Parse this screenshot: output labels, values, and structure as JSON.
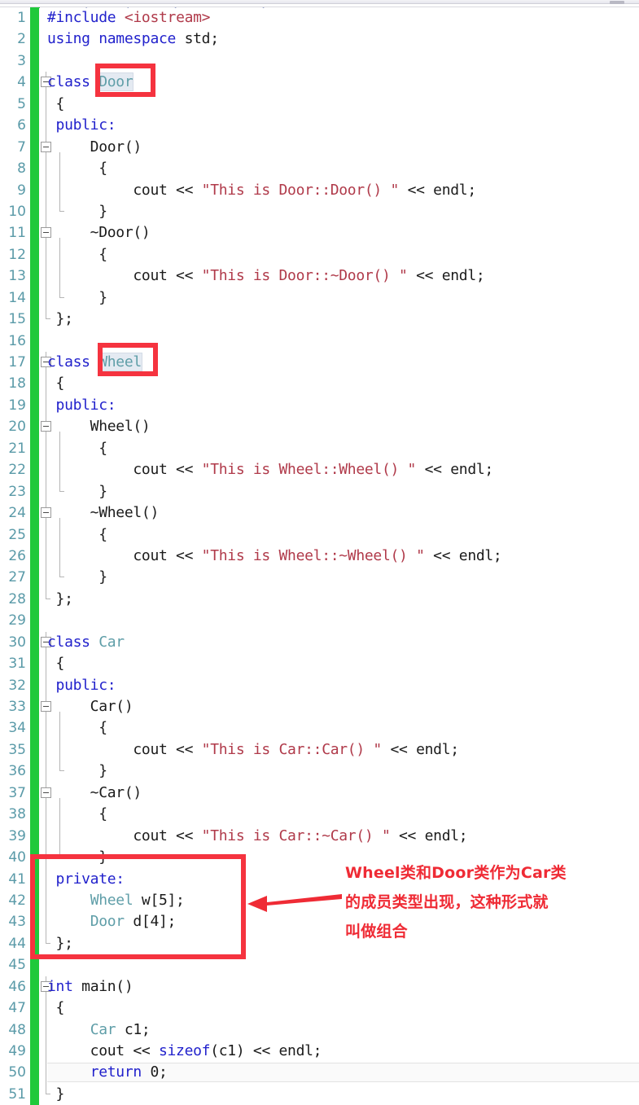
{
  "app": {
    "type": "code-editor",
    "language": "C++",
    "total_lines_visible": 51
  },
  "theme": {
    "background": "#ffffff",
    "line_number_color": "#5a9aa8",
    "keyword_color": "#2222cc",
    "class_name_color": "#5f9ea8",
    "string_color": "#b03a4a",
    "plain_text_color": "#1b1b1b",
    "change_bar_color": "#1fc93b",
    "annotation_color": "#ef2b35",
    "selection_background": "#e4eaf2",
    "current_line_background": "#fafafa"
  },
  "top_strip": {
    "scrollbar_name": "horizontal-scrollbar",
    "cropped_ghost_text": "└─  ┐    │     /         \\"
  },
  "lines": [
    {
      "n": "1",
      "fold": "none",
      "indent": 0,
      "tokens": [
        {
          "t": "#include ",
          "c": "pre"
        },
        {
          "t": "<iostream>",
          "c": "hdr"
        }
      ]
    },
    {
      "n": "2",
      "fold": "none",
      "indent": 0,
      "tokens": [
        {
          "t": "using namespace ",
          "c": "kw"
        },
        {
          "t": "std;",
          "c": "plain"
        }
      ]
    },
    {
      "n": "3",
      "fold": "none",
      "indent": 0,
      "tokens": []
    },
    {
      "n": "4",
      "fold": "box-start",
      "indent": 0,
      "tokens": [
        {
          "t": "class ",
          "c": "kw"
        },
        {
          "t": "Door",
          "c": "cls sel"
        }
      ]
    },
    {
      "n": "5",
      "fold": "line",
      "indent": 0,
      "tokens": [
        {
          "t": " {",
          "c": "plain"
        }
      ]
    },
    {
      "n": "6",
      "fold": "line",
      "indent": 0,
      "tokens": [
        {
          "t": " public:",
          "c": "kw"
        }
      ]
    },
    {
      "n": "7",
      "fold": "box-inner",
      "indent": 0,
      "tokens": [
        {
          "t": "     Door()",
          "c": "plain"
        }
      ]
    },
    {
      "n": "8",
      "fold": "line",
      "indent": 0,
      "tokens": [
        {
          "t": "      {",
          "c": "plain"
        }
      ]
    },
    {
      "n": "9",
      "fold": "line",
      "indent": 0,
      "tokens": [
        {
          "t": "          cout << ",
          "c": "plain"
        },
        {
          "t": "\"This is Door::Door() \"",
          "c": "str"
        },
        {
          "t": " << endl;",
          "c": "plain"
        }
      ]
    },
    {
      "n": "10",
      "fold": "line-end",
      "indent": 0,
      "tokens": [
        {
          "t": "      }",
          "c": "plain"
        }
      ]
    },
    {
      "n": "11",
      "fold": "box-inner",
      "indent": 0,
      "tokens": [
        {
          "t": "     ~Door()",
          "c": "plain"
        }
      ]
    },
    {
      "n": "12",
      "fold": "line",
      "indent": 0,
      "tokens": [
        {
          "t": "      {",
          "c": "plain"
        }
      ]
    },
    {
      "n": "13",
      "fold": "line",
      "indent": 0,
      "tokens": [
        {
          "t": "          cout << ",
          "c": "plain"
        },
        {
          "t": "\"This is Door::~Door() \"",
          "c": "str"
        },
        {
          "t": " << endl;",
          "c": "plain"
        }
      ]
    },
    {
      "n": "14",
      "fold": "line-end",
      "indent": 0,
      "tokens": [
        {
          "t": "      }",
          "c": "plain"
        }
      ]
    },
    {
      "n": "15",
      "fold": "end",
      "indent": 0,
      "tokens": [
        {
          "t": " };",
          "c": "plain"
        }
      ]
    },
    {
      "n": "16",
      "fold": "none",
      "indent": 0,
      "tokens": []
    },
    {
      "n": "17",
      "fold": "box-start",
      "indent": 0,
      "tokens": [
        {
          "t": "class ",
          "c": "kw"
        },
        {
          "t": "Wheel",
          "c": "cls sel"
        }
      ]
    },
    {
      "n": "18",
      "fold": "line",
      "indent": 0,
      "tokens": [
        {
          "t": " {",
          "c": "plain"
        }
      ]
    },
    {
      "n": "19",
      "fold": "line",
      "indent": 0,
      "tokens": [
        {
          "t": " public:",
          "c": "kw"
        }
      ]
    },
    {
      "n": "20",
      "fold": "box-inner",
      "indent": 0,
      "tokens": [
        {
          "t": "     Wheel()",
          "c": "plain"
        }
      ]
    },
    {
      "n": "21",
      "fold": "line",
      "indent": 0,
      "tokens": [
        {
          "t": "      {",
          "c": "plain"
        }
      ]
    },
    {
      "n": "22",
      "fold": "line",
      "indent": 0,
      "tokens": [
        {
          "t": "          cout << ",
          "c": "plain"
        },
        {
          "t": "\"This is Wheel::Wheel() \"",
          "c": "str"
        },
        {
          "t": " << endl;",
          "c": "plain"
        }
      ]
    },
    {
      "n": "23",
      "fold": "line-end",
      "indent": 0,
      "tokens": [
        {
          "t": "      }",
          "c": "plain"
        }
      ]
    },
    {
      "n": "24",
      "fold": "box-inner",
      "indent": 0,
      "tokens": [
        {
          "t": "     ~Wheel()",
          "c": "plain"
        }
      ]
    },
    {
      "n": "25",
      "fold": "line",
      "indent": 0,
      "tokens": [
        {
          "t": "      {",
          "c": "plain"
        }
      ]
    },
    {
      "n": "26",
      "fold": "line",
      "indent": 0,
      "tokens": [
        {
          "t": "          cout << ",
          "c": "plain"
        },
        {
          "t": "\"This is Wheel::~Wheel() \"",
          "c": "str"
        },
        {
          "t": " << endl;",
          "c": "plain"
        }
      ]
    },
    {
      "n": "27",
      "fold": "line-end",
      "indent": 0,
      "tokens": [
        {
          "t": "      }",
          "c": "plain"
        }
      ]
    },
    {
      "n": "28",
      "fold": "end",
      "indent": 0,
      "tokens": [
        {
          "t": " };",
          "c": "plain"
        }
      ]
    },
    {
      "n": "29",
      "fold": "none",
      "indent": 0,
      "tokens": []
    },
    {
      "n": "30",
      "fold": "box-start",
      "indent": 0,
      "tokens": [
        {
          "t": "class ",
          "c": "kw"
        },
        {
          "t": "Car",
          "c": "cls"
        }
      ]
    },
    {
      "n": "31",
      "fold": "line",
      "indent": 0,
      "tokens": [
        {
          "t": " {",
          "c": "plain"
        }
      ]
    },
    {
      "n": "32",
      "fold": "line",
      "indent": 0,
      "tokens": [
        {
          "t": " public:",
          "c": "kw"
        }
      ]
    },
    {
      "n": "33",
      "fold": "box-inner",
      "indent": 0,
      "tokens": [
        {
          "t": "     Car()",
          "c": "plain"
        }
      ]
    },
    {
      "n": "34",
      "fold": "line",
      "indent": 0,
      "tokens": [
        {
          "t": "      {",
          "c": "plain"
        }
      ]
    },
    {
      "n": "35",
      "fold": "line",
      "indent": 0,
      "tokens": [
        {
          "t": "          cout << ",
          "c": "plain"
        },
        {
          "t": "\"This is Car::Car() \"",
          "c": "str"
        },
        {
          "t": " << endl;",
          "c": "plain"
        }
      ]
    },
    {
      "n": "36",
      "fold": "line-end",
      "indent": 0,
      "tokens": [
        {
          "t": "      }",
          "c": "plain"
        }
      ]
    },
    {
      "n": "37",
      "fold": "box-inner",
      "indent": 0,
      "tokens": [
        {
          "t": "     ~Car()",
          "c": "plain"
        }
      ]
    },
    {
      "n": "38",
      "fold": "line",
      "indent": 0,
      "tokens": [
        {
          "t": "      {",
          "c": "plain"
        }
      ]
    },
    {
      "n": "39",
      "fold": "line",
      "indent": 0,
      "tokens": [
        {
          "t": "          cout << ",
          "c": "plain"
        },
        {
          "t": "\"This is Car::~Car() \"",
          "c": "str"
        },
        {
          "t": " << endl;",
          "c": "plain"
        }
      ]
    },
    {
      "n": "40",
      "fold": "line-end",
      "indent": 0,
      "tokens": [
        {
          "t": "      }",
          "c": "plain"
        }
      ]
    },
    {
      "n": "41",
      "fold": "line",
      "indent": 0,
      "tokens": [
        {
          "t": " private:",
          "c": "kw"
        }
      ]
    },
    {
      "n": "42",
      "fold": "line",
      "indent": 0,
      "tokens": [
        {
          "t": "     ",
          "c": "plain"
        },
        {
          "t": "Wheel",
          "c": "cls"
        },
        {
          "t": " w[5];",
          "c": "plain"
        }
      ]
    },
    {
      "n": "43",
      "fold": "line",
      "indent": 0,
      "tokens": [
        {
          "t": "     ",
          "c": "plain"
        },
        {
          "t": "Door",
          "c": "cls"
        },
        {
          "t": " d[4];",
          "c": "plain"
        }
      ]
    },
    {
      "n": "44",
      "fold": "end",
      "indent": 0,
      "tokens": [
        {
          "t": " };",
          "c": "plain"
        }
      ]
    },
    {
      "n": "45",
      "fold": "none",
      "indent": 0,
      "tokens": []
    },
    {
      "n": "46",
      "fold": "box-start",
      "indent": 0,
      "tokens": [
        {
          "t": "int ",
          "c": "kw"
        },
        {
          "t": "main()",
          "c": "plain"
        }
      ]
    },
    {
      "n": "47",
      "fold": "line",
      "indent": 0,
      "tokens": [
        {
          "t": " {",
          "c": "plain"
        }
      ]
    },
    {
      "n": "48",
      "fold": "line",
      "indent": 0,
      "tokens": [
        {
          "t": "     ",
          "c": "plain"
        },
        {
          "t": "Car",
          "c": "cls"
        },
        {
          "t": " c1;",
          "c": "plain"
        }
      ]
    },
    {
      "n": "49",
      "fold": "line",
      "indent": 0,
      "tokens": [
        {
          "t": "     cout << ",
          "c": "plain"
        },
        {
          "t": "sizeof",
          "c": "kw"
        },
        {
          "t": "(c1) << endl;",
          "c": "plain"
        }
      ]
    },
    {
      "n": "50",
      "fold": "line",
      "current": true,
      "indent": 0,
      "tokens": [
        {
          "t": "     ",
          "c": "plain"
        },
        {
          "t": "return",
          "c": "kw"
        },
        {
          "t": " 0;",
          "c": "plain"
        }
      ]
    },
    {
      "n": "51",
      "fold": "end",
      "indent": 0,
      "tokens": [
        {
          "t": " }",
          "c": "plain"
        }
      ]
    }
  ],
  "annotations": {
    "boxes": [
      {
        "name": "highlight-box-door",
        "target": "Door class name on line 4"
      },
      {
        "name": "highlight-box-wheel",
        "target": "Wheel class name on line 17"
      },
      {
        "name": "highlight-box-private",
        "target": "private member block lines 41-44"
      }
    ],
    "arrow": {
      "name": "annotation-arrow",
      "direction": "left"
    },
    "note_lines": [
      "Wheel类和Door类作为Car类",
      "的成员类型出现，这种形式就",
      "叫做组合"
    ]
  }
}
